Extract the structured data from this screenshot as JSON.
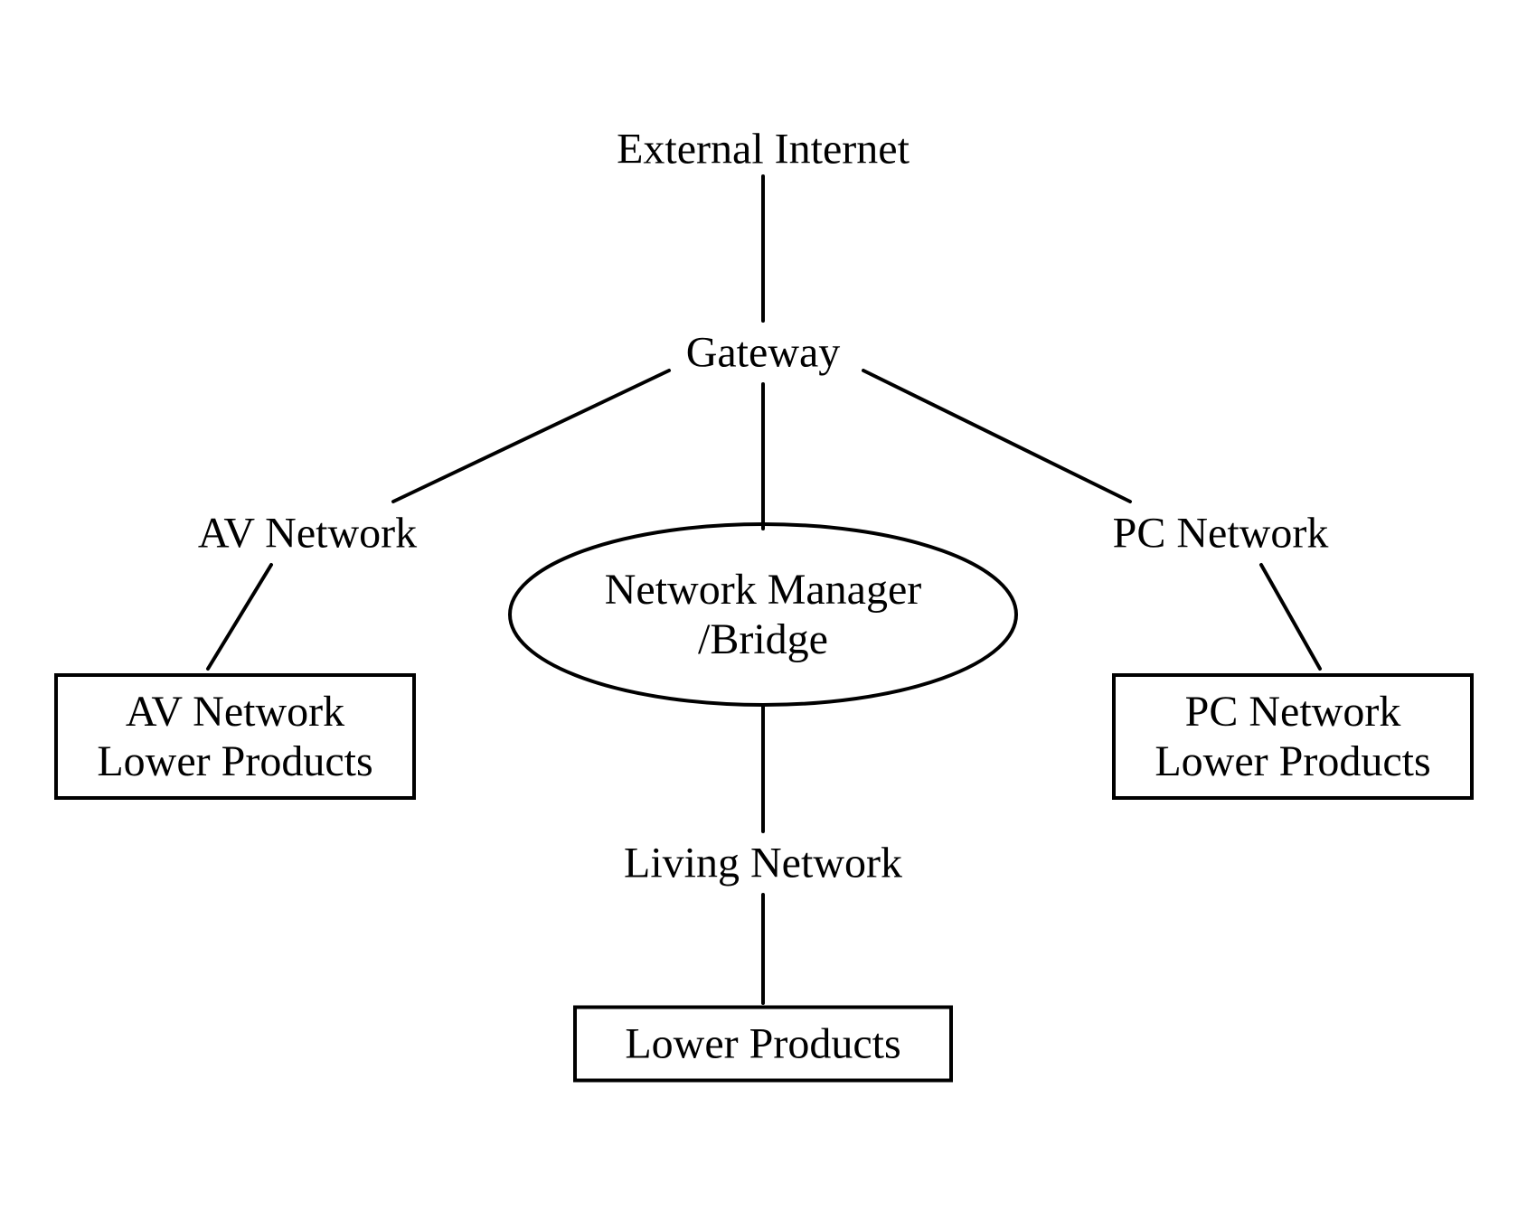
{
  "nodes": {
    "external_internet": "External Internet",
    "gateway": "Gateway",
    "av_network": "AV Network",
    "pc_network": "PC Network",
    "network_manager_line1": "Network Manager",
    "network_manager_line2": "/Bridge",
    "av_box_line1": "AV Network",
    "av_box_line2": "Lower Products",
    "pc_box_line1": "PC Network",
    "pc_box_line2": "Lower Products",
    "living_network": "Living Network",
    "lower_products": "Lower Products"
  }
}
